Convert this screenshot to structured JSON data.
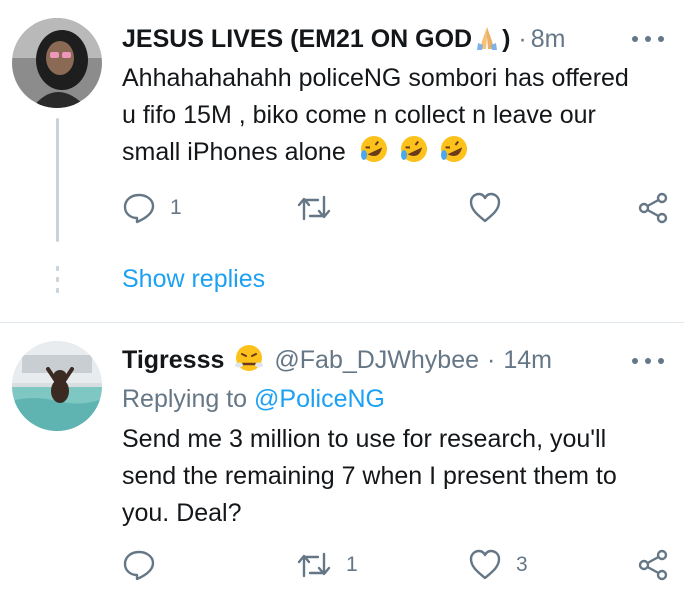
{
  "tweets": [
    {
      "name": "JESUS LIVES (EM21 ON GOD",
      "name_suffix": ")",
      "name_emoji": "folded-hands",
      "handle": "",
      "separator": "·",
      "time": "8m",
      "replying_label": "",
      "replying_to": "",
      "text": "Ahhahahahahh policeNG sombori has offered u fifo 15M , biko come n collect n leave our small iPhones alone",
      "text_emojis": [
        "rolling-on-floor-laughing",
        "rolling-on-floor-laughing",
        "rolling-on-floor-laughing"
      ],
      "replies": "1",
      "retweets": "",
      "likes": "",
      "show_replies": "Show replies"
    },
    {
      "name": "Tigresss",
      "name_emoji": "face-with-steam",
      "handle": "@Fab_DJWhybee",
      "separator": "·",
      "time": "14m",
      "replying_label": "Replying to",
      "replying_to": "@PoliceNG",
      "text": "Send me 3 million to use for research, you'll send the remaining 7 when I present them to you. Deal?",
      "replies": "",
      "retweets": "1",
      "likes": "3"
    }
  ],
  "icons": [
    "reply-icon",
    "retweet-icon",
    "like-icon",
    "share-icon",
    "more-icon"
  ],
  "colors": {
    "text": "#14171a",
    "secondary": "#657786",
    "link": "#1da1f2",
    "divider": "#e1e8ed",
    "thread": "#c8d3db"
  }
}
